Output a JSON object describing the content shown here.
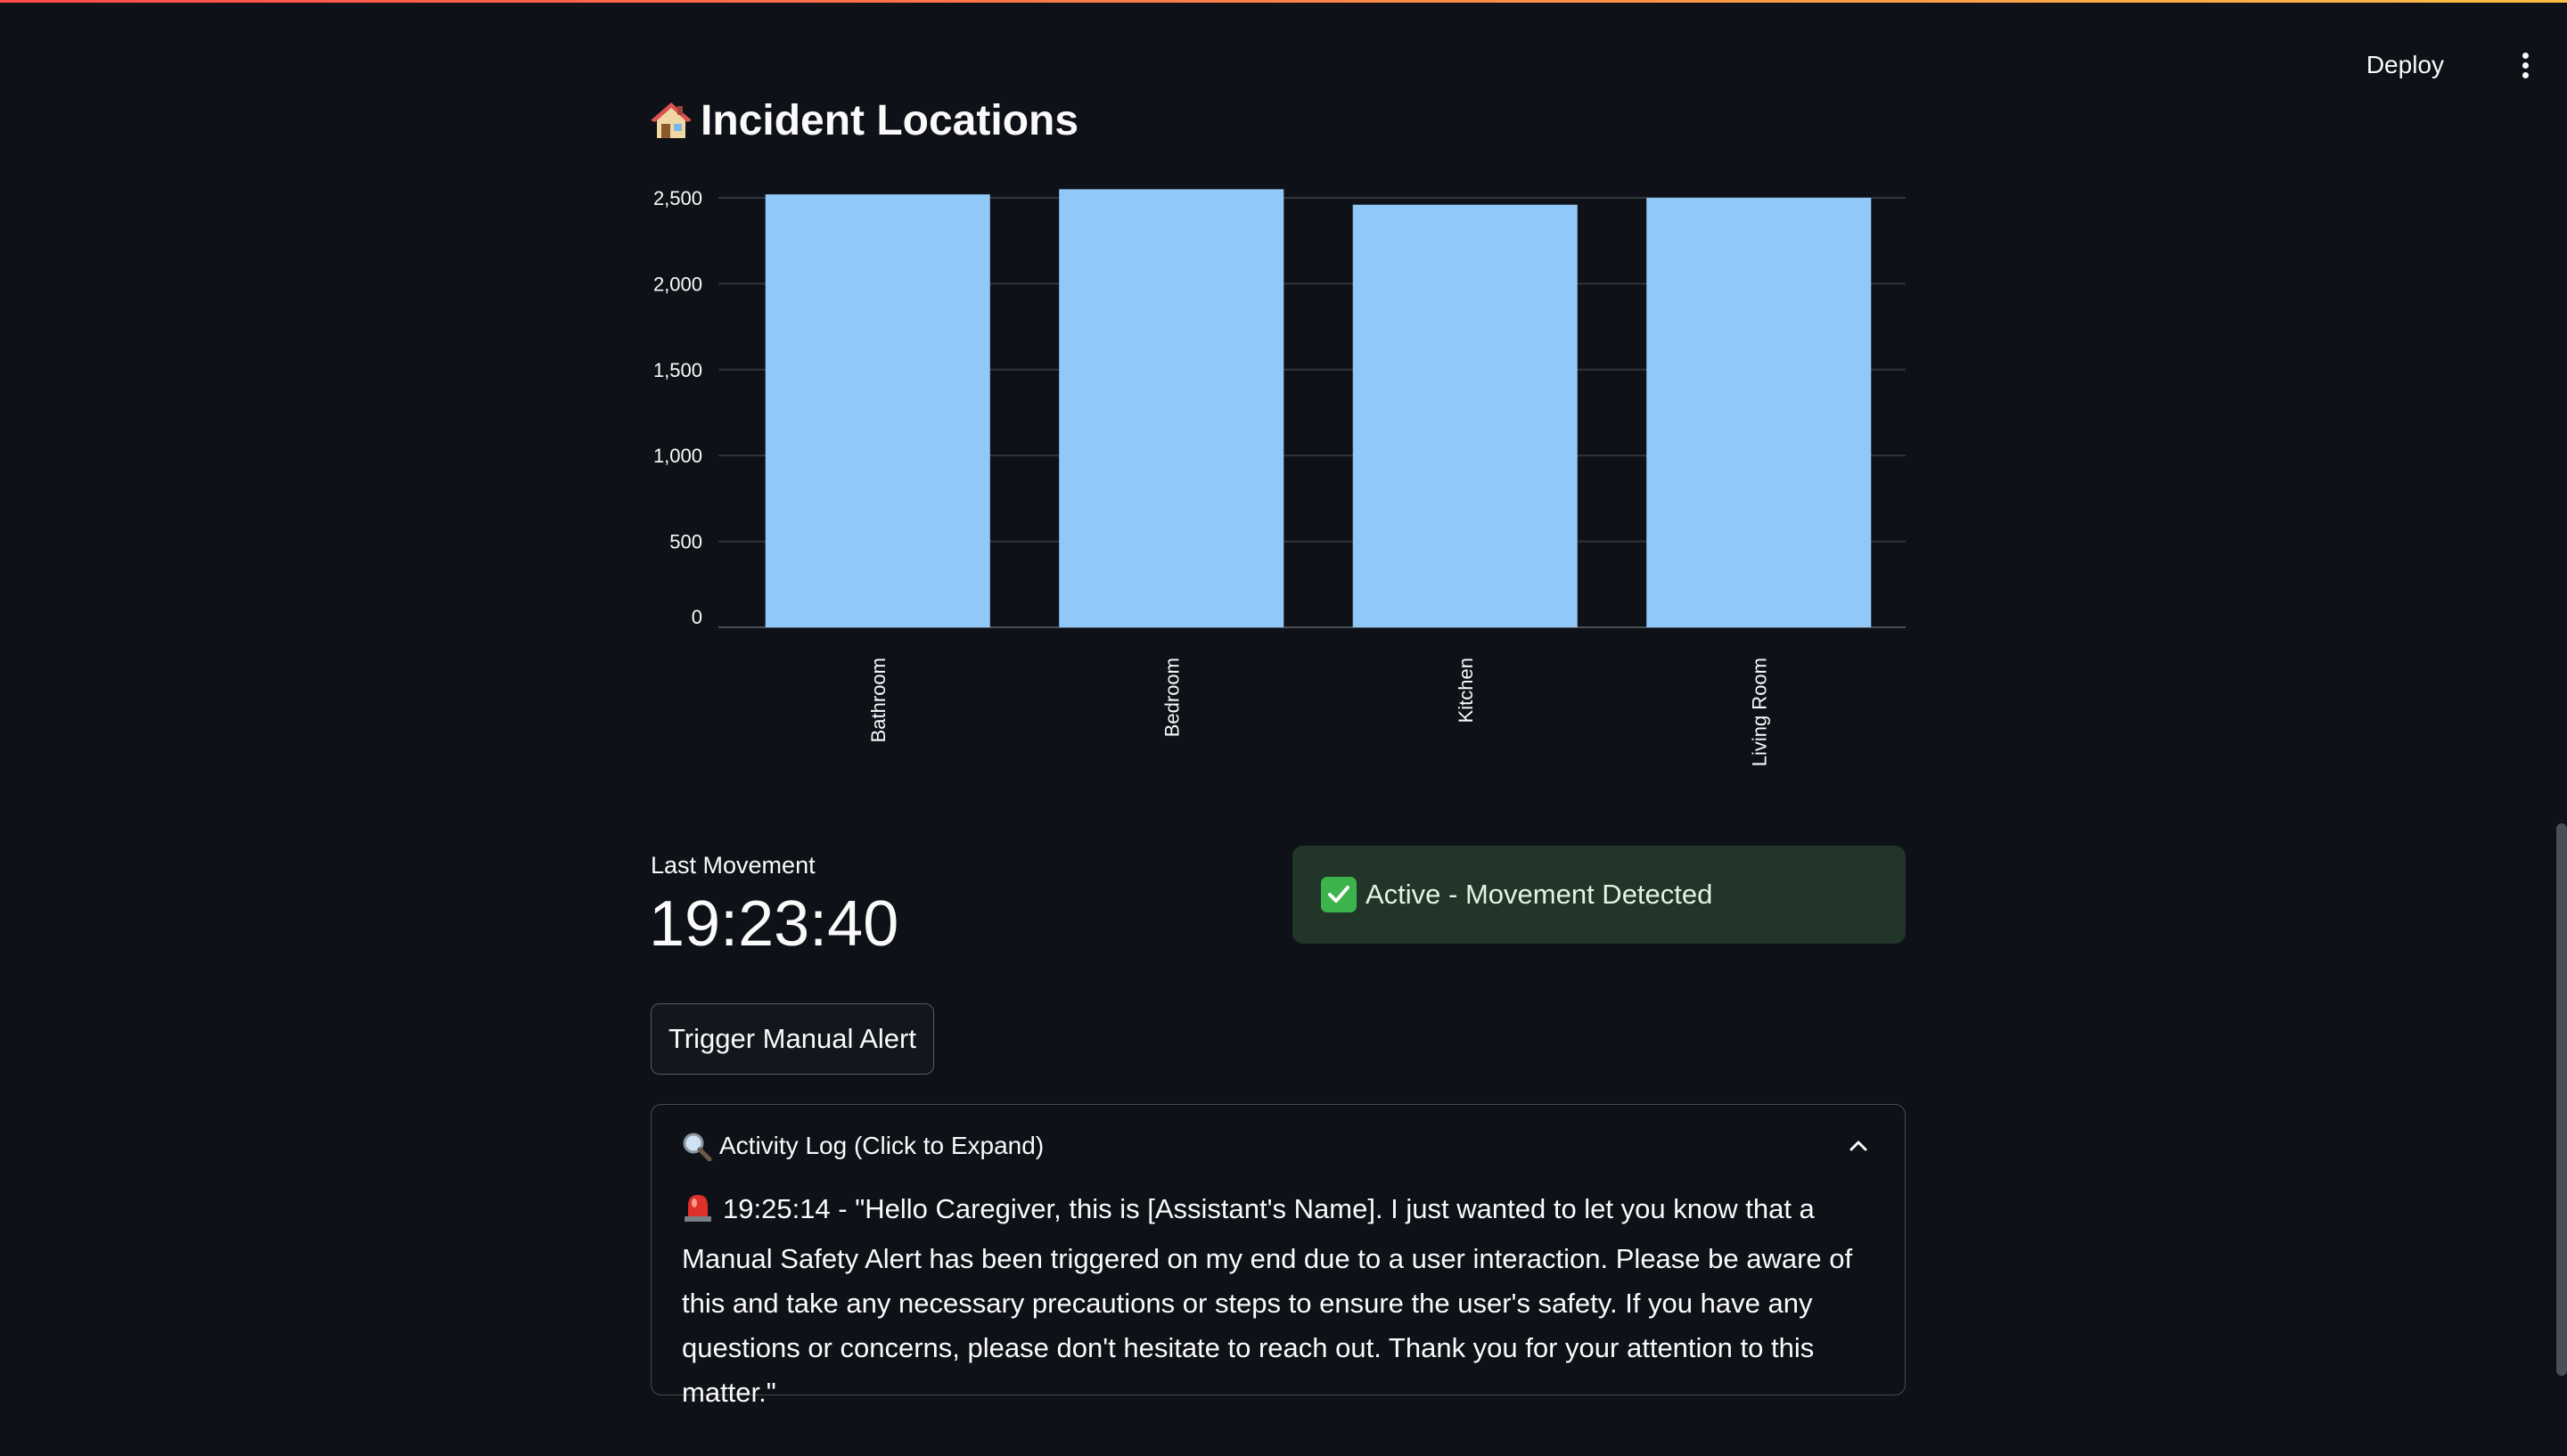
{
  "toolbar": {
    "deploy_label": "Deploy"
  },
  "section": {
    "title": "Incident Locations",
    "title_icon": "house-icon"
  },
  "chart_data": {
    "type": "bar",
    "title": "",
    "xlabel": "",
    "ylabel": "",
    "categories": [
      "Bathroom",
      "Bedroom",
      "Kitchen",
      "Living Room"
    ],
    "values": [
      2520,
      2550,
      2460,
      2500
    ],
    "ylim": [
      0,
      2500
    ],
    "yticks": [
      0,
      500,
      1000,
      1500,
      2000,
      2500
    ],
    "ytick_labels": [
      "0",
      "500",
      "1,000",
      "1,500",
      "2,000",
      "2,500"
    ],
    "grid": true,
    "bar_color": "#90c8f8"
  },
  "metric": {
    "label": "Last Movement",
    "value": "19:23:40"
  },
  "status": {
    "text": "Active - Movement Detected",
    "icon": "check-mark-icon",
    "color": "#213529"
  },
  "actions": {
    "trigger_label": "Trigger Manual Alert"
  },
  "activity_log": {
    "title": "Activity Log (Click to Expand)",
    "entries": [
      {
        "icon": "siren-icon",
        "text": "19:25:14 - \"Hello Caregiver, this is [Assistant's Name]. I just wanted to let you know that a Manual Safety Alert has been triggered on my end due to a user interaction. Please be aware of this and take any necessary precautions or steps to ensure the user's safety. If you have any questions or concerns, please don't hesitate to reach out. Thank you for your attention to this matter.\""
      }
    ]
  }
}
